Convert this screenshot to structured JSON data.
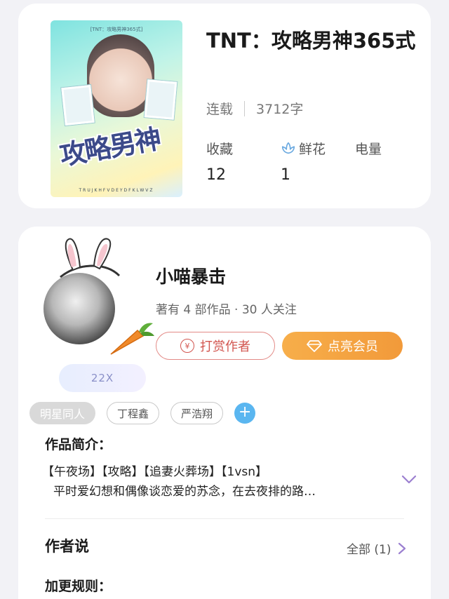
{
  "book": {
    "cover_top_text": "[TNT：攻略男神365式]",
    "cover_title": "攻略男神",
    "cover_bottom_text": "TRUJKHFVDEYDFKLWVZ",
    "title": "TNT：攻略男神365式",
    "status": "连载",
    "word_count": "3712字",
    "stats": [
      {
        "label": "收藏",
        "value": "12",
        "icon": ""
      },
      {
        "label": "鲜花",
        "value": "1",
        "icon": "flower-icon"
      },
      {
        "label": "电量",
        "value": "",
        "icon": ""
      }
    ]
  },
  "author": {
    "name": "小喵暴击",
    "meta": "著有 4 部作品 · 30 人关注",
    "level_badge": "22X",
    "tip_button": "打赏作者",
    "tip_icon": "¥",
    "vip_button": "点亮会员"
  },
  "tags": [
    {
      "label": "明星同人",
      "primary": true
    },
    {
      "label": "丁程鑫",
      "primary": false
    },
    {
      "label": "严浩翔",
      "primary": false
    }
  ],
  "add_tag_label": "+",
  "intro": {
    "heading": "作品简介：",
    "line1": "【午夜场】【攻略】【追妻火葬场】【1vsn】",
    "line2": "平时爱幻想和偶像谈恋爱的苏念，在去夜排的路…"
  },
  "author_says": {
    "heading": "作者说",
    "all_link": "全部 (1)"
  },
  "update_rules": {
    "heading": "加更规则："
  },
  "colors": {
    "page_bg": "#f2f2f6",
    "tip_red": "#d2554f",
    "vip_orange": "#f29a3a",
    "accent_purple": "#9b7fd0",
    "add_blue": "#5ab6f0"
  }
}
